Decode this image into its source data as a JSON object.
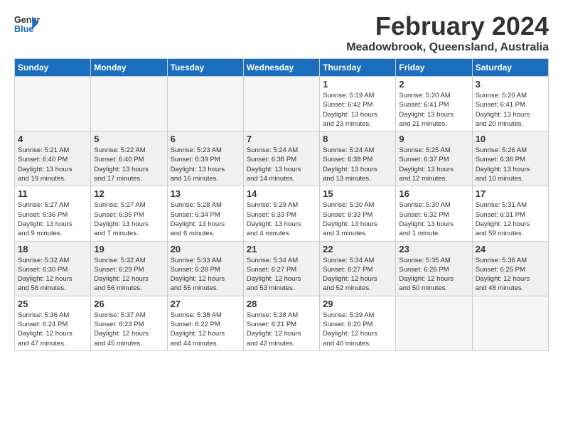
{
  "header": {
    "logo_line1": "General",
    "logo_line2": "Blue",
    "title": "February 2024",
    "subtitle": "Meadowbrook, Queensland, Australia"
  },
  "weekdays": [
    "Sunday",
    "Monday",
    "Tuesday",
    "Wednesday",
    "Thursday",
    "Friday",
    "Saturday"
  ],
  "weeks": [
    [
      {
        "day": "",
        "info": ""
      },
      {
        "day": "",
        "info": ""
      },
      {
        "day": "",
        "info": ""
      },
      {
        "day": "",
        "info": ""
      },
      {
        "day": "1",
        "info": "Sunrise: 5:19 AM\nSunset: 6:42 PM\nDaylight: 13 hours\nand 23 minutes."
      },
      {
        "day": "2",
        "info": "Sunrise: 5:20 AM\nSunset: 6:41 PM\nDaylight: 13 hours\nand 21 minutes."
      },
      {
        "day": "3",
        "info": "Sunrise: 5:20 AM\nSunset: 6:41 PM\nDaylight: 13 hours\nand 20 minutes."
      }
    ],
    [
      {
        "day": "4",
        "info": "Sunrise: 5:21 AM\nSunset: 6:40 PM\nDaylight: 13 hours\nand 19 minutes."
      },
      {
        "day": "5",
        "info": "Sunrise: 5:22 AM\nSunset: 6:40 PM\nDaylight: 13 hours\nand 17 minutes."
      },
      {
        "day": "6",
        "info": "Sunrise: 5:23 AM\nSunset: 6:39 PM\nDaylight: 13 hours\nand 16 minutes."
      },
      {
        "day": "7",
        "info": "Sunrise: 5:24 AM\nSunset: 6:38 PM\nDaylight: 13 hours\nand 14 minutes."
      },
      {
        "day": "8",
        "info": "Sunrise: 5:24 AM\nSunset: 6:38 PM\nDaylight: 13 hours\nand 13 minutes."
      },
      {
        "day": "9",
        "info": "Sunrise: 5:25 AM\nSunset: 6:37 PM\nDaylight: 13 hours\nand 12 minutes."
      },
      {
        "day": "10",
        "info": "Sunrise: 5:26 AM\nSunset: 6:36 PM\nDaylight: 13 hours\nand 10 minutes."
      }
    ],
    [
      {
        "day": "11",
        "info": "Sunrise: 5:27 AM\nSunset: 6:36 PM\nDaylight: 13 hours\nand 9 minutes."
      },
      {
        "day": "12",
        "info": "Sunrise: 5:27 AM\nSunset: 6:35 PM\nDaylight: 13 hours\nand 7 minutes."
      },
      {
        "day": "13",
        "info": "Sunrise: 5:28 AM\nSunset: 6:34 PM\nDaylight: 13 hours\nand 6 minutes."
      },
      {
        "day": "14",
        "info": "Sunrise: 5:29 AM\nSunset: 6:33 PM\nDaylight: 13 hours\nand 4 minutes."
      },
      {
        "day": "15",
        "info": "Sunrise: 5:30 AM\nSunset: 6:33 PM\nDaylight: 13 hours\nand 3 minutes."
      },
      {
        "day": "16",
        "info": "Sunrise: 5:30 AM\nSunset: 6:32 PM\nDaylight: 13 hours\nand 1 minute."
      },
      {
        "day": "17",
        "info": "Sunrise: 5:31 AM\nSunset: 6:31 PM\nDaylight: 12 hours\nand 59 minutes."
      }
    ],
    [
      {
        "day": "18",
        "info": "Sunrise: 5:32 AM\nSunset: 6:30 PM\nDaylight: 12 hours\nand 58 minutes."
      },
      {
        "day": "19",
        "info": "Sunrise: 5:32 AM\nSunset: 6:29 PM\nDaylight: 12 hours\nand 56 minutes."
      },
      {
        "day": "20",
        "info": "Sunrise: 5:33 AM\nSunset: 6:28 PM\nDaylight: 12 hours\nand 55 minutes."
      },
      {
        "day": "21",
        "info": "Sunrise: 5:34 AM\nSunset: 6:27 PM\nDaylight: 12 hours\nand 53 minutes."
      },
      {
        "day": "22",
        "info": "Sunrise: 5:34 AM\nSunset: 6:27 PM\nDaylight: 12 hours\nand 52 minutes."
      },
      {
        "day": "23",
        "info": "Sunrise: 5:35 AM\nSunset: 6:26 PM\nDaylight: 12 hours\nand 50 minutes."
      },
      {
        "day": "24",
        "info": "Sunrise: 5:36 AM\nSunset: 6:25 PM\nDaylight: 12 hours\nand 48 minutes."
      }
    ],
    [
      {
        "day": "25",
        "info": "Sunrise: 5:36 AM\nSunset: 6:24 PM\nDaylight: 12 hours\nand 47 minutes."
      },
      {
        "day": "26",
        "info": "Sunrise: 5:37 AM\nSunset: 6:23 PM\nDaylight: 12 hours\nand 45 minutes."
      },
      {
        "day": "27",
        "info": "Sunrise: 5:38 AM\nSunset: 6:22 PM\nDaylight: 12 hours\nand 44 minutes."
      },
      {
        "day": "28",
        "info": "Sunrise: 5:38 AM\nSunset: 6:21 PM\nDaylight: 12 hours\nand 42 minutes."
      },
      {
        "day": "29",
        "info": "Sunrise: 5:39 AM\nSunset: 6:20 PM\nDaylight: 12 hours\nand 40 minutes."
      },
      {
        "day": "",
        "info": ""
      },
      {
        "day": "",
        "info": ""
      }
    ]
  ]
}
